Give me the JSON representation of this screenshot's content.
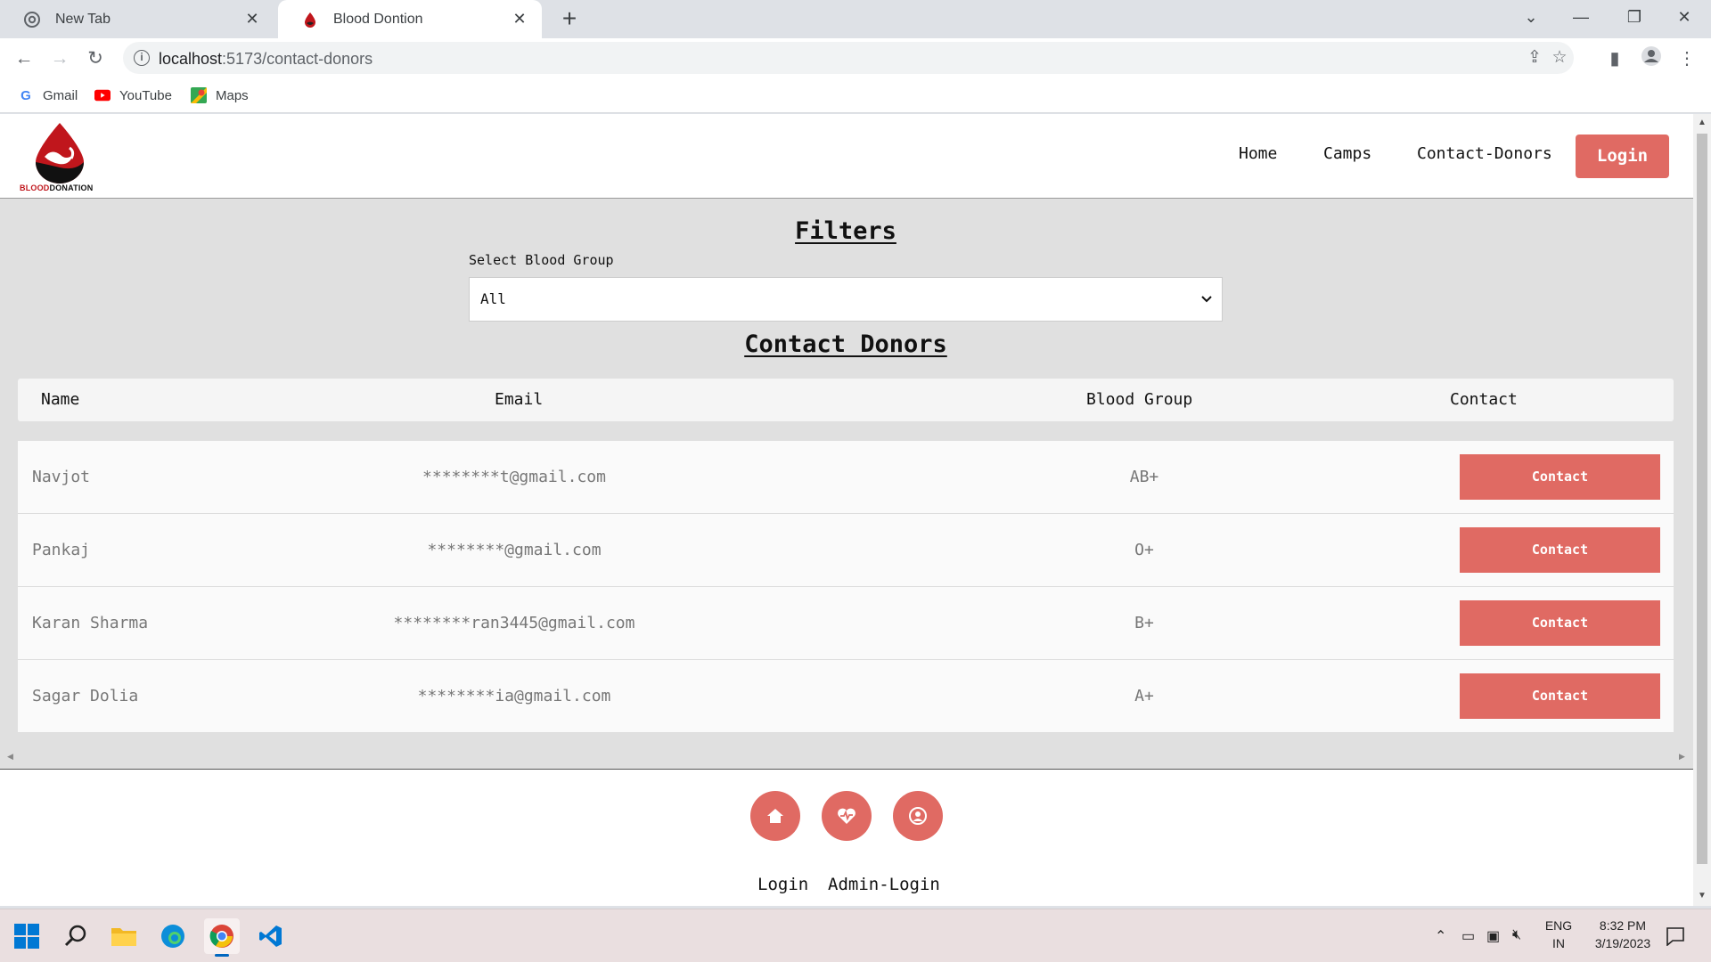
{
  "browser": {
    "tabs": [
      {
        "title": "New Tab"
      },
      {
        "title": "Blood Dontion"
      }
    ],
    "url": {
      "host": "localhost",
      "path": ":5173/contact-donors"
    },
    "bookmarks": [
      {
        "label": "Gmail"
      },
      {
        "label": "YouTube"
      },
      {
        "label": "Maps"
      }
    ]
  },
  "site": {
    "logo_text": {
      "part1": "BLOOD",
      "part2": "DONATION"
    },
    "nav": {
      "home": "Home",
      "camps": "Camps",
      "contact_donors": "Contact-Donors",
      "login": "Login"
    },
    "filters": {
      "title": "Filters",
      "select_label": "Select Blood Group",
      "selected": "All"
    },
    "donors_title": "Contact Donors",
    "table": {
      "headers": {
        "name": "Name",
        "email": "Email",
        "group": "Blood Group",
        "contact": "Contact"
      },
      "rows": [
        {
          "name": "Navjot",
          "email": "********t@gmail.com",
          "group": "AB+",
          "button": "Contact"
        },
        {
          "name": "Pankaj",
          "email": "********@gmail.com",
          "group": "O+",
          "button": "Contact"
        },
        {
          "name": "Karan Sharma",
          "email": "********ran3445@gmail.com",
          "group": "B+",
          "button": "Contact"
        },
        {
          "name": "Sagar Dolia",
          "email": "********ia@gmail.com",
          "group": "A+",
          "button": "Contact"
        }
      ]
    },
    "footer": {
      "icons": [
        "home-icon",
        "heartbeat-icon",
        "user-icon"
      ],
      "links": {
        "login": "Login",
        "admin_login": "Admin-Login"
      }
    }
  },
  "taskbar": {
    "lang": {
      "line1": "ENG",
      "line2": "IN"
    },
    "time": "8:32 PM",
    "date": "3/19/2023"
  },
  "colors": {
    "accent": "#e06a63",
    "brand_red": "#c0161c"
  }
}
